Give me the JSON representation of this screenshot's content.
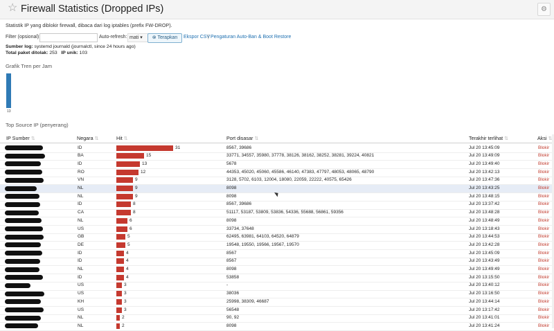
{
  "header": {
    "title": "Firewall Statistics (Dropped IPs)",
    "star_icon": "star-icon",
    "settings_icon": "gear-icon"
  },
  "description": "Statistik IP yang diblokir firewall, dibaca dari log iptables (prefix FW-DROP).",
  "filter": {
    "label": "Filter (opsional):",
    "value": "",
    "autorefresh_label": "Auto-refresh:",
    "autorefresh_value": "mati",
    "apply_label": "Terapkan",
    "export_label": "Ekspor CSV",
    "separator": "|",
    "settings_label": "Pengaturan Auto-Ban & Boot Restore"
  },
  "summary": {
    "source_label": "Sumber log:",
    "source_value": "systemd journald (journalctl, since 24 hours ago)",
    "total_label": "Total paket ditolak:",
    "total_value": "253",
    "unique_label": "IP unik:",
    "unique_value": "103"
  },
  "trend": {
    "title": "Grafik Tren per Jam",
    "bars": [
      {
        "label": "13",
        "value": 1
      }
    ]
  },
  "table": {
    "title": "Top Source IP (penyerang)",
    "columns": [
      "IP Sumber",
      "Negara",
      "Hit",
      "Port disasar",
      "Terakhir terlihat",
      "Aksi"
    ],
    "max_hit": 31,
    "rows": [
      {
        "country": "ID",
        "hit": 31,
        "ports": "8567, 39686",
        "last": "Jul 20 13:45:09",
        "action": "Blokir"
      },
      {
        "country": "BA",
        "hit": 15,
        "ports": "33771, 34557, 35980, 37778, 38126, 38162, 38252, 38281, 39224, 40821",
        "last": "Jul 20 13:49:09",
        "action": "Blokir"
      },
      {
        "country": "ID",
        "hit": 13,
        "ports": "5678",
        "last": "Jul 20 13:49:40",
        "action": "Blokir"
      },
      {
        "country": "RO",
        "hit": 12,
        "ports": "44353, 45020, 45060, 45586, 46140, 47383, 47797, 48053, 48065, 48790",
        "last": "Jul 20 13:42:13",
        "action": "Blokir"
      },
      {
        "country": "VN",
        "hit": 9,
        "ports": "3128, 5702, 6103, 12004, 18080, 22059, 22222, 40575, 65426",
        "last": "Jul 20 13:47:36",
        "action": "Blokir"
      },
      {
        "country": "NL",
        "hit": 9,
        "ports": "8098",
        "last": "Jul 20 13:43:25",
        "action": "Blokir"
      },
      {
        "country": "NL",
        "hit": 9,
        "ports": "8098",
        "last": "Jul 20 13:48:15",
        "action": "Blokir"
      },
      {
        "country": "ID",
        "hit": 8,
        "ports": "8567, 39686",
        "last": "Jul 20 13:37:42",
        "action": "Blokir"
      },
      {
        "country": "CA",
        "hit": 8,
        "ports": "51117, 53187, 53809, 53836, 54336, 55688, 56861, 59356",
        "last": "Jul 20 13:48:28",
        "action": "Blokir"
      },
      {
        "country": "NL",
        "hit": 6,
        "ports": "8098",
        "last": "Jul 20 13:48:49",
        "action": "Blokir"
      },
      {
        "country": "US",
        "hit": 6,
        "ports": "33734, 37648",
        "last": "Jul 20 13:18:43",
        "action": "Blokir"
      },
      {
        "country": "GB",
        "hit": 5,
        "ports": "62495, 63981, 64103, 64520, 64879",
        "last": "Jul 20 13:44:53",
        "action": "Blokir"
      },
      {
        "country": "DE",
        "hit": 5,
        "ports": "19548, 19550, 19566, 19567, 19570",
        "last": "Jul 20 13:42:28",
        "action": "Blokir"
      },
      {
        "country": "ID",
        "hit": 4,
        "ports": "8567",
        "last": "Jul 20 13:45:09",
        "action": "Blokir"
      },
      {
        "country": "ID",
        "hit": 4,
        "ports": "8567",
        "last": "Jul 20 13:43:49",
        "action": "Blokir"
      },
      {
        "country": "NL",
        "hit": 4,
        "ports": "8098",
        "last": "Jul 20 13:49:49",
        "action": "Blokir"
      },
      {
        "country": "ID",
        "hit": 4,
        "ports": "53858",
        "last": "Jul 20 13:15:50",
        "action": "Blokir"
      },
      {
        "country": "US",
        "hit": 3,
        "ports": "-",
        "last": "Jul 20 13:40:12",
        "action": "Blokir"
      },
      {
        "country": "US",
        "hit": 3,
        "ports": "38036",
        "last": "Jul 20 13:16:50",
        "action": "Blokir"
      },
      {
        "country": "KH",
        "hit": 3,
        "ports": "25998, 38309, 46687",
        "last": "Jul 20 13:44:14",
        "action": "Blokir"
      },
      {
        "country": "US",
        "hit": 3,
        "ports": "56548",
        "last": "Jul 20 13:17:42",
        "action": "Blokir"
      },
      {
        "country": "NL",
        "hit": 2,
        "ports": "90, 92",
        "last": "Jul 20 13:41:01",
        "action": "Blokir"
      },
      {
        "country": "NL",
        "hit": 2,
        "ports": "8098",
        "last": "Jul 20 13:41:24",
        "action": "Blokir"
      }
    ]
  }
}
